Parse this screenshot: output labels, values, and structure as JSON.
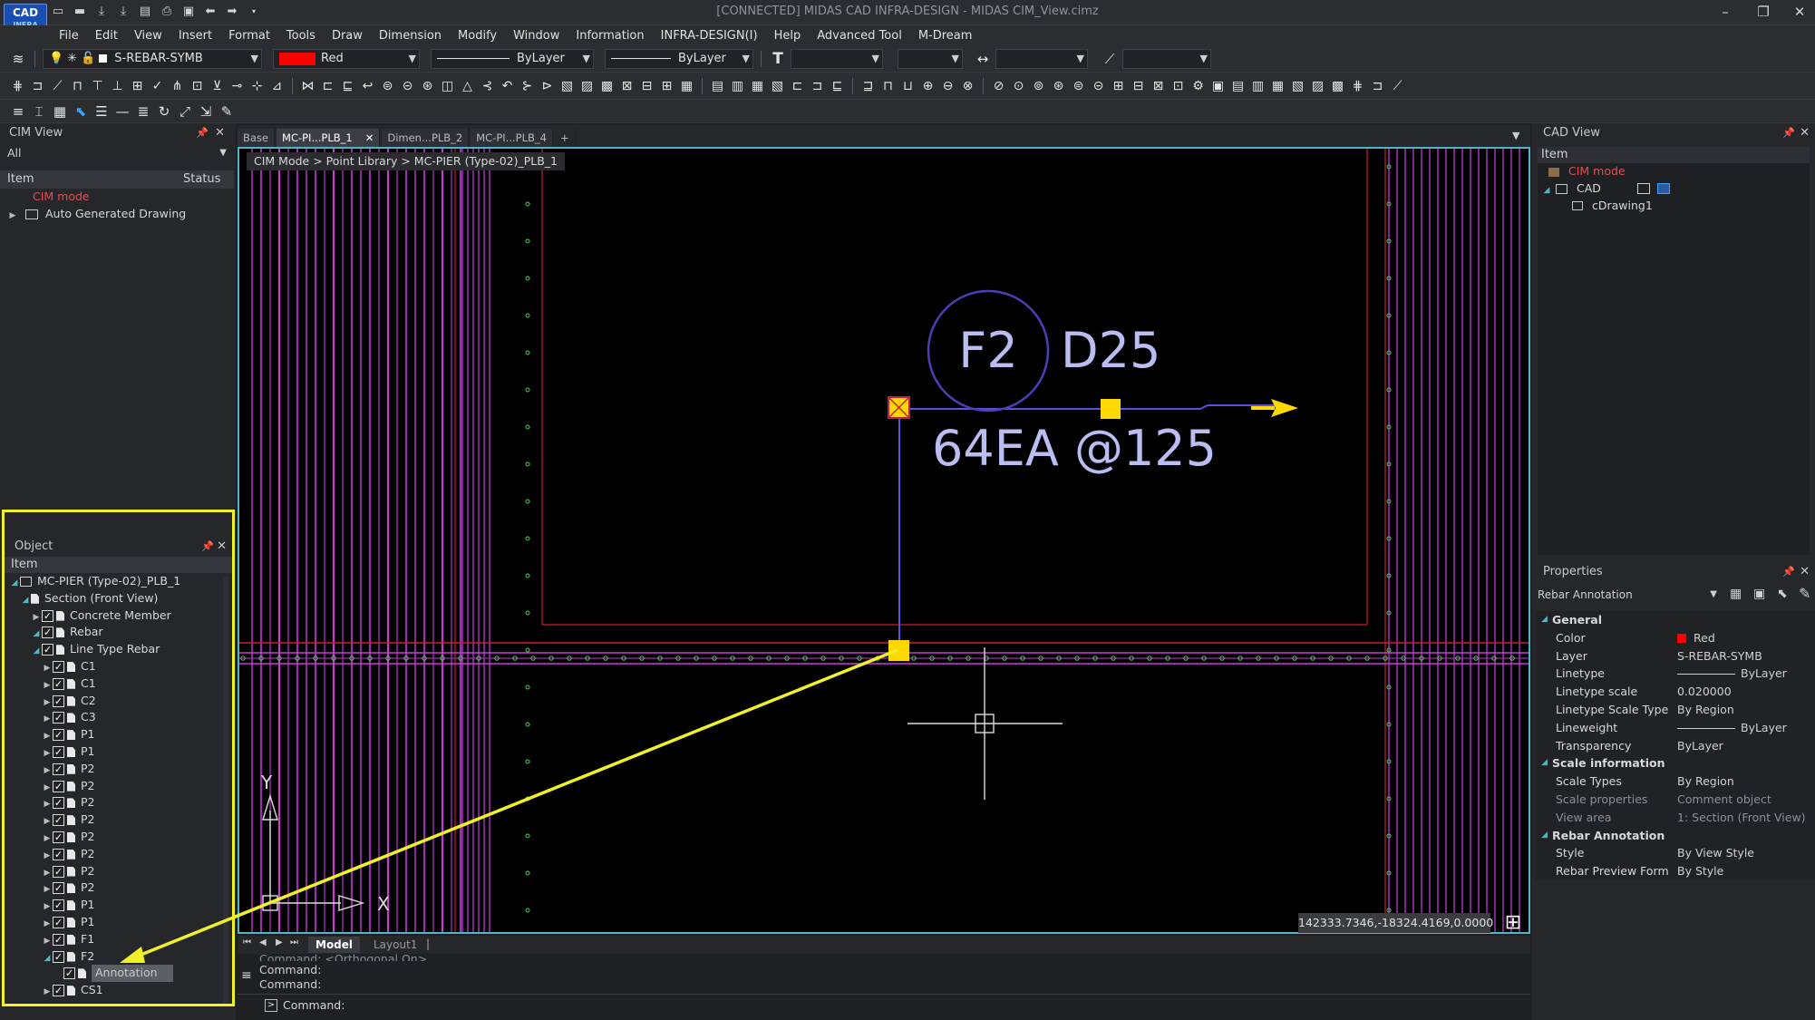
{
  "app": {
    "icon_label": "CAD",
    "icon_sub": "INFRA",
    "title": "[CONNECTED] MIDAS CAD INFRA-DESIGN - MIDAS CIM_View.cimz"
  },
  "menu": [
    "File",
    "Edit",
    "View",
    "Insert",
    "Format",
    "Tools",
    "Draw",
    "Dimension",
    "Modify",
    "Window",
    "Information",
    "INFRA-DESIGN(I)",
    "Help",
    "Advanced Tool",
    "M-Dream"
  ],
  "props_toolbar": {
    "layer": "S-REBAR-SYMB",
    "color": "Red",
    "color_hex": "#ff0000",
    "linetype": "ByLayer",
    "lineweight": "ByLayer"
  },
  "cim_view": {
    "title": "CIM View",
    "filter": "All",
    "col_item": "Item",
    "col_status": "Status",
    "items": [
      "CIM mode",
      "Auto Generated Drawing"
    ]
  },
  "object_panel": {
    "title": "Object",
    "col_item": "Item",
    "tree": [
      {
        "label": "MC-PIER (Type-02)_PLB_1",
        "level": 0
      },
      {
        "label": "Section (Front View)",
        "level": 1
      },
      {
        "label": "Concrete Member",
        "level": 2
      },
      {
        "label": "Rebar",
        "level": 2
      },
      {
        "label": "Line Type Rebar",
        "level": 3
      },
      {
        "label": "C1",
        "level": 4
      },
      {
        "label": "C1",
        "level": 4
      },
      {
        "label": "C2",
        "level": 4
      },
      {
        "label": "C3",
        "level": 4
      },
      {
        "label": "P1",
        "level": 4
      },
      {
        "label": "P1",
        "level": 4
      },
      {
        "label": "P2",
        "level": 4
      },
      {
        "label": "P2",
        "level": 4
      },
      {
        "label": "P2",
        "level": 4
      },
      {
        "label": "P2",
        "level": 4
      },
      {
        "label": "P2",
        "level": 4
      },
      {
        "label": "P2",
        "level": 4
      },
      {
        "label": "P2",
        "level": 4
      },
      {
        "label": "P2",
        "level": 4
      },
      {
        "label": "P1",
        "level": 4
      },
      {
        "label": "P1",
        "level": 4
      },
      {
        "label": "F1",
        "level": 4
      },
      {
        "label": "F2",
        "level": 4
      },
      {
        "label": "Annotation",
        "level": 5
      },
      {
        "label": "CS1",
        "level": 4
      }
    ]
  },
  "tabs": [
    "Base",
    "MC-PI...PLB_1",
    "Dimen...PLB_2",
    "MC-PI...PLB_4"
  ],
  "breadcrumb": "CIM Mode > Point Library > MC-PIER (Type-02)_PLB_1",
  "annotation": {
    "mark": "F2",
    "dia": "D25",
    "qty": "64EA @125"
  },
  "ucs": {
    "x": "X",
    "y": "Y"
  },
  "coordinates": "142333.7346,-18324.4169,0.0000",
  "layout_tabs": [
    "Model",
    "Layout1"
  ],
  "command": {
    "lines": [
      "Command: <Orthogonal On>",
      "Command:",
      "Command:"
    ],
    "prompt": "Command:"
  },
  "cad_view": {
    "title": "CAD View",
    "col_item": "Item",
    "items": [
      "CIM mode",
      "CAD",
      "cDrawing1"
    ]
  },
  "properties": {
    "title": "Properties",
    "selection": "Rebar Annotation",
    "rows": [
      {
        "cat": true,
        "k": "General"
      },
      {
        "k": "Color",
        "v": "Red"
      },
      {
        "k": "Layer",
        "v": "S-REBAR-SYMB"
      },
      {
        "k": "Linetype",
        "v": "ByLayer"
      },
      {
        "k": "Linetype scale",
        "v": "0.020000"
      },
      {
        "k": "Linetype Scale Type",
        "v": "By Region"
      },
      {
        "k": "Lineweight",
        "v": "ByLayer"
      },
      {
        "k": "Transparency",
        "v": "ByLayer"
      },
      {
        "cat": true,
        "k": "Scale information"
      },
      {
        "k": "Scale Types",
        "v": "By Region"
      },
      {
        "k": "Scale properties",
        "v": "Comment object",
        "dim": true
      },
      {
        "k": "View area",
        "v": "1: Section (Front View)",
        "dim": true
      },
      {
        "cat": true,
        "k": "Rebar Annotation"
      },
      {
        "k": "Style",
        "v": "By View Style"
      },
      {
        "k": "Rebar Preview Form",
        "v": "By Style"
      }
    ]
  }
}
